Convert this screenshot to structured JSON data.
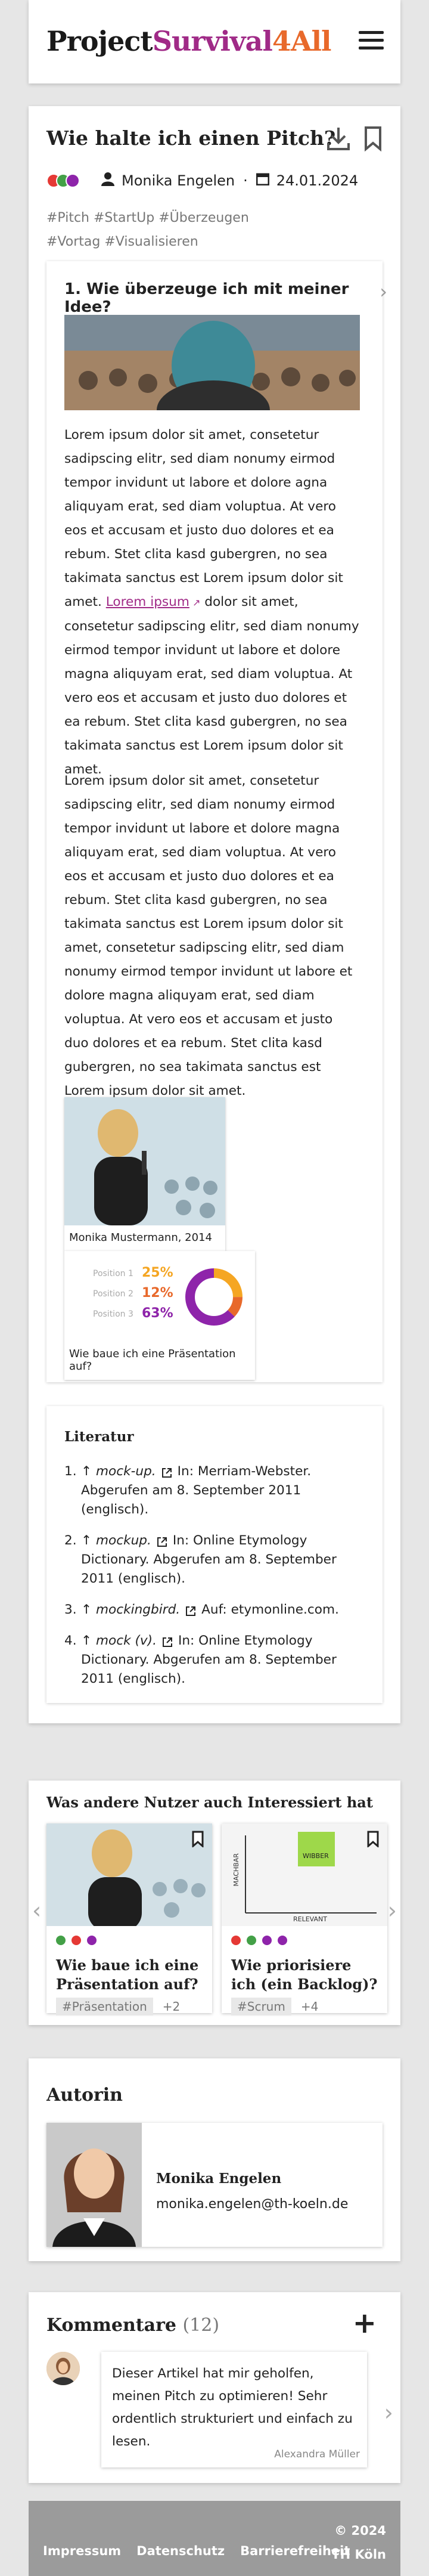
{
  "header": {
    "logo_part1": "Project",
    "logo_part2": "Survival",
    "logo_part3": "4All"
  },
  "article": {
    "title": "Wie halte ich einen Pitch?",
    "author": "Monika Engelen",
    "date": "24.01.2024",
    "tags_line1": "#Pitch #StartUp #Überzeugen",
    "tags_line2": "#Vortag #Visualisieren",
    "dot_colors": [
      "#e53935",
      "#43a047",
      "#8e24aa"
    ],
    "section_title": "1. Wie überzeuge ich mit meiner Idee?",
    "para1_a": "Lorem ipsum dolor sit amet, consetetur sadipscing elitr, sed diam nonumy eirmod tempor invidunt ut labore et dolore agna aliquyam erat, sed diam voluptua. At vero eos et accusam et justo duo dolores et ea rebum. Stet clita kasd gubergren, no sea takimata sanctus est Lorem ipsum dolor sit amet. ",
    "para1_link": "Lorem ipsum",
    "para1_b": " dolor sit amet, consetetur sadipscing elitr, sed diam nonumy eirmod tempor invidunt ut labore et dolore magna aliquyam erat, sed diam voluptua. At vero eos et accusam et justo duo dolores et ea rebum. Stet clita kasd gubergren, no sea takimata sanctus est Lorem ipsum dolor sit amet.",
    "para2": "Lorem ipsum dolor sit amet, consetetur sadipscing elitr, sed diam nonumy eirmod tempor invidunt ut labore et dolore magna aliquyam erat, sed diam voluptua. At vero eos et accusam et justo duo dolores et ea rebum. Stet clita kasd gubergren, no sea takimata sanctus est Lorem ipsum dolor sit amet, consetetur sadipscing elitr, sed diam nonumy eirmod tempor invidunt ut labore et dolore magna aliquyam erat, sed diam voluptua. At vero eos et accusam et justo duo dolores et ea rebum. Stet clita kasd gubergren, no sea takimata sanctus est Lorem ipsum dolor sit amet.",
    "figure1_caption": "Monika Mustermann, 2014",
    "figure2_caption": "Wie baue ich eine Präsentation auf?",
    "figure2_rows": [
      {
        "label": "Position 1",
        "value": "25%",
        "color": "#f5a623"
      },
      {
        "label": "Position 2",
        "value": "12%",
        "color": "#e8692b"
      },
      {
        "label": "Position 3",
        "value": "63%",
        "color": "#8e24aa"
      }
    ]
  },
  "literature": {
    "title": "Literatur",
    "items": [
      {
        "num": "1.",
        "term": "mock-up.",
        "text": "In: Merriam-Webster. Abgerufen am 8. September 2011 (englisch)."
      },
      {
        "num": "2.",
        "term": "mockup.",
        "text": "In: Online Etymology Dictionary. Abgerufen am 8. September 2011 (englisch)."
      },
      {
        "num": "3.",
        "term": "mockingbird.",
        "text": "Auf: etymonline.com."
      },
      {
        "num": "4.",
        "term": "mock (v).",
        "text": "In: Online Etymology Dictionary. Abgerufen am 8. September 2011 (englisch)."
      }
    ],
    "arrow": "↑"
  },
  "related": {
    "title": "Was andere Nutzer auch Interessiert hat",
    "cards": [
      {
        "title": "Wie baue ich eine Präsentation auf?",
        "tag": "#Präsentation",
        "more": "+2",
        "dots": [
          "#43a047",
          "#e53935",
          "#8e24aa"
        ]
      },
      {
        "title": "Wie priorisiere ich (ein Backlog)?",
        "tag": "#Scrum",
        "more": "+4",
        "dots": [
          "#e53935",
          "#43a047",
          "#8e24aa",
          "#8e24aa"
        ]
      }
    ],
    "card2_axis_y": "MACHBAR",
    "card2_axis_x": "RELEVANT",
    "card2_note": "WIBBER"
  },
  "author": {
    "title": "Autorin",
    "name": "Monika Engelen",
    "email": "monika.engelen@th-koeln.de"
  },
  "comments": {
    "title": "Kommentare",
    "count": "(12)",
    "text": "Dieser Artikel hat mir geholfen, meinen Pitch zu optimieren! Sehr ordentlich strukturiert und einfach zu lesen.",
    "author": "Alexandra Müller"
  },
  "footer": {
    "links": [
      "Impressum",
      "Datenschutz",
      "Barrierefreiheit"
    ],
    "copyright": "© 2024",
    "org": "TH Köln"
  }
}
